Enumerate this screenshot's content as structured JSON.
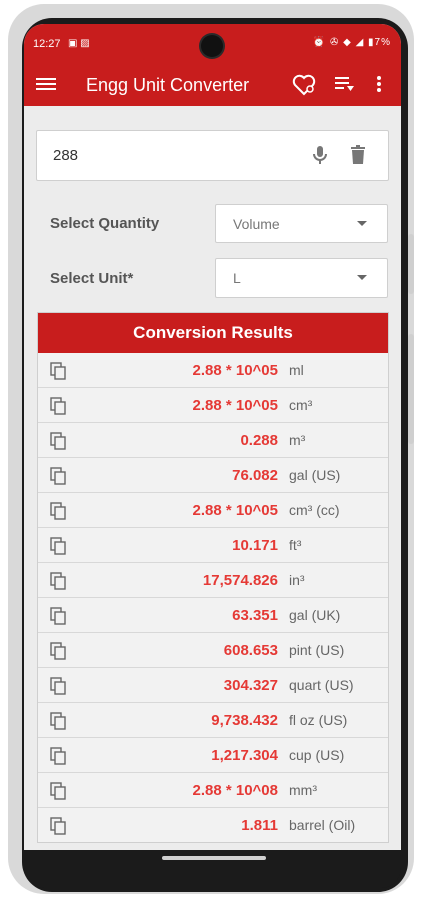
{
  "status_bar": {
    "time": "12:27",
    "left_icons": "▣ ▨",
    "right_icons": "⏰ ✇ ◆ ◢ ▮7%"
  },
  "app_bar": {
    "title": "Engg Unit Converter"
  },
  "input": {
    "value": "288"
  },
  "quantity": {
    "label": "Select Quantity",
    "selected": "Volume"
  },
  "unit": {
    "label": "Select Unit*",
    "selected": "L"
  },
  "results": {
    "header": "Conversion Results",
    "rows": [
      {
        "value": "2.88 * 10^05",
        "unit": "ml"
      },
      {
        "value": "2.88 * 10^05",
        "unit": "cm³"
      },
      {
        "value": "0.288",
        "unit": "m³"
      },
      {
        "value": "76.082",
        "unit": "gal (US)"
      },
      {
        "value": "2.88 * 10^05",
        "unit": "cm³ (cc)"
      },
      {
        "value": "10.171",
        "unit": "ft³"
      },
      {
        "value": "17,574.826",
        "unit": "in³"
      },
      {
        "value": "63.351",
        "unit": "gal (UK)"
      },
      {
        "value": "608.653",
        "unit": "pint (US)"
      },
      {
        "value": "304.327",
        "unit": "quart (US)"
      },
      {
        "value": "9,738.432",
        "unit": "fl oz (US)"
      },
      {
        "value": "1,217.304",
        "unit": "cup (US)"
      },
      {
        "value": "2.88 * 10^08",
        "unit": "mm³"
      },
      {
        "value": "1.811",
        "unit": "barrel (Oil)"
      }
    ]
  },
  "colors": {
    "accent": "#c81d1d",
    "value_red": "#e53935"
  }
}
